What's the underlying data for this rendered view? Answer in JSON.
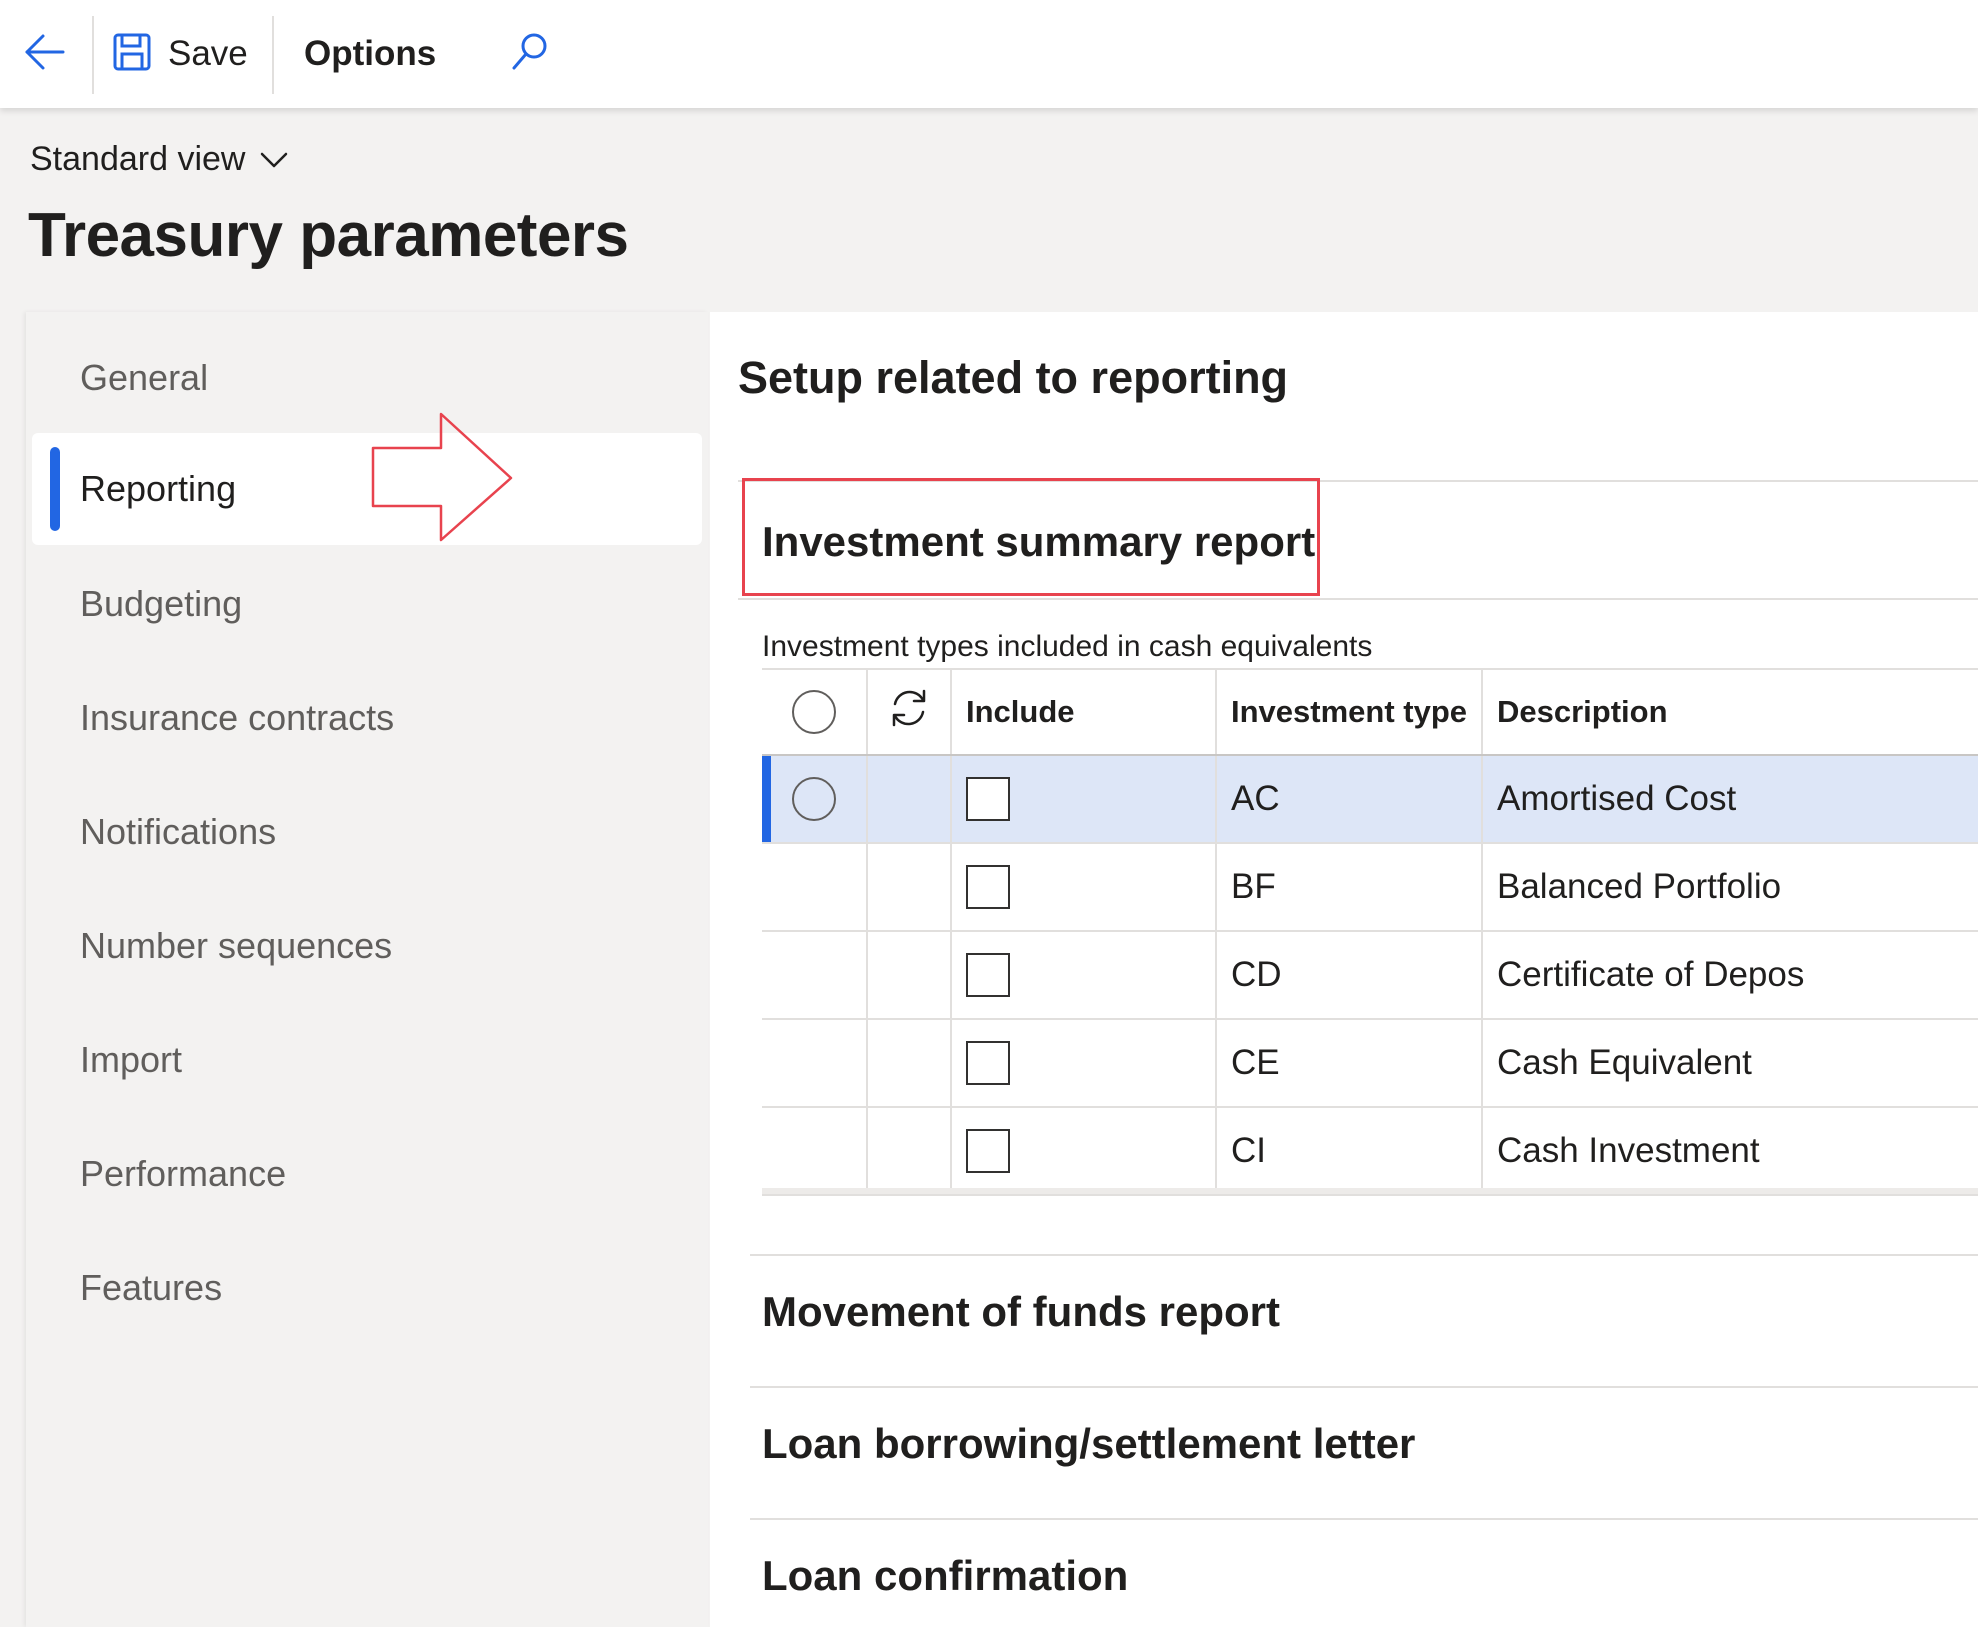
{
  "toolbar": {
    "back_icon": "arrow-left-icon",
    "save_icon": "floppy-disk-icon",
    "save_label": "Save",
    "options_label": "Options",
    "search_icon": "search-icon"
  },
  "header": {
    "view_label": "Standard view",
    "view_chevron_icon": "chevron-down-icon",
    "title": "Treasury parameters"
  },
  "sidebar": {
    "items": [
      {
        "label": "General",
        "selected": false
      },
      {
        "label": "Reporting",
        "selected": true
      },
      {
        "label": "Budgeting",
        "selected": false
      },
      {
        "label": "Insurance contracts",
        "selected": false
      },
      {
        "label": "Notifications",
        "selected": false
      },
      {
        "label": "Number sequences",
        "selected": false
      },
      {
        "label": "Import",
        "selected": false
      },
      {
        "label": "Performance",
        "selected": false
      },
      {
        "label": "Features",
        "selected": false
      }
    ]
  },
  "main": {
    "title": "Setup related to reporting",
    "sections": [
      {
        "title": "Investment summary report",
        "expanded": true
      },
      {
        "title": "Movement of funds report",
        "expanded": false
      },
      {
        "title": "Loan borrowing/settlement letter",
        "expanded": false
      },
      {
        "title": "Loan confirmation",
        "expanded": false
      }
    ],
    "grid": {
      "caption": "Investment types included in cash equivalents",
      "columns": [
        "Include",
        "Investment type",
        "Description"
      ],
      "rows": [
        {
          "include": false,
          "type": "AC",
          "description": "Amortised Cost",
          "selected": true
        },
        {
          "include": false,
          "type": "BF",
          "description": "Balanced Portfolio",
          "selected": false
        },
        {
          "include": false,
          "type": "CD",
          "description": "Certificate of Depos",
          "selected": false
        },
        {
          "include": false,
          "type": "CE",
          "description": "Cash Equivalent",
          "selected": false
        },
        {
          "include": false,
          "type": "CI",
          "description": "Cash Investment",
          "selected": false
        }
      ]
    }
  },
  "colors": {
    "accent": "#2266e3",
    "annotation": "#e8434e",
    "selected_row": "#dde6f7"
  }
}
